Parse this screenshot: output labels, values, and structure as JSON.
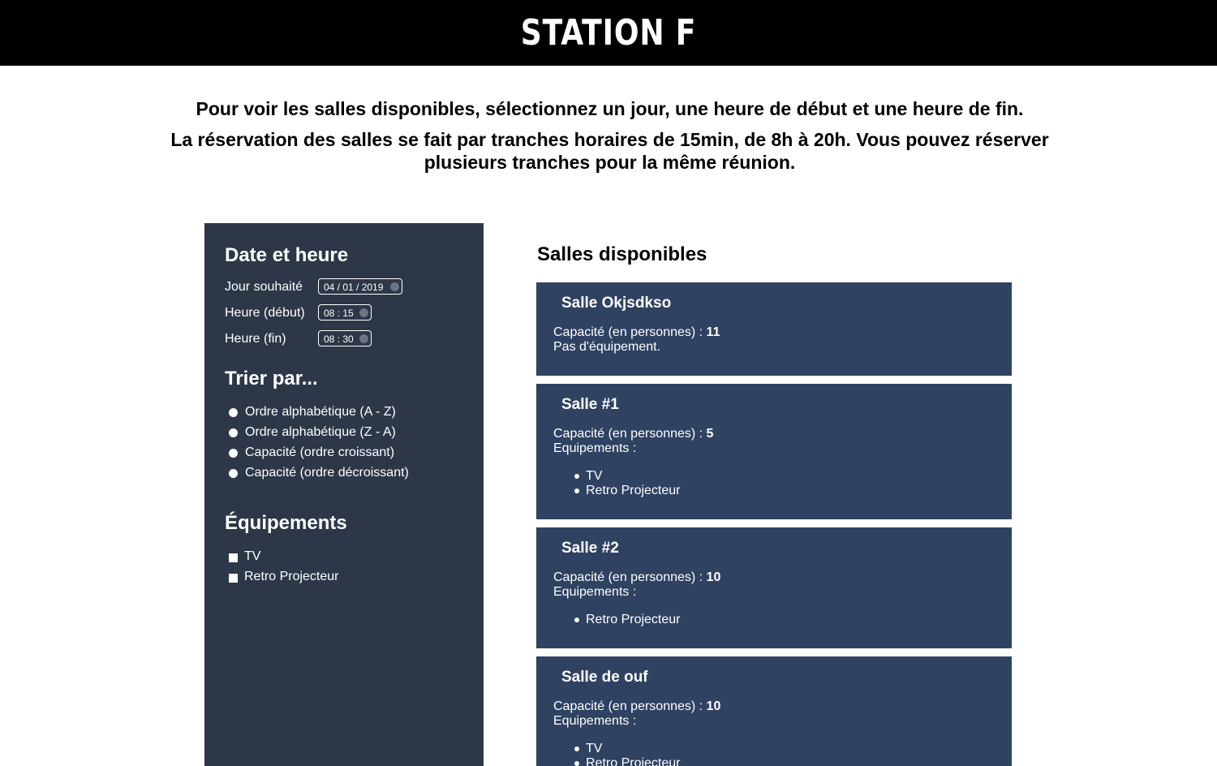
{
  "header": {
    "logo_text": "STATION F"
  },
  "intro": {
    "line1": "Pour voir les salles disponibles, sélectionnez un jour, une heure de début et une heure de fin.",
    "line2": "La réservation des salles se fait par tranches horaires de 15min, de 8h à 20h. Vous pouvez réserver plusieurs tranches pour la même réunion."
  },
  "sidebar": {
    "datetime_heading": "Date et heure",
    "fields": [
      {
        "label": "Jour souhaité",
        "value": "04 / 01 / 2019"
      },
      {
        "label": "Heure (début)",
        "value": "08 : 15"
      },
      {
        "label": "Heure (fin)",
        "value": "08 : 30"
      }
    ],
    "sort_heading": "Trier par...",
    "sort_options": [
      "Ordre alphabétique (A - Z)",
      "Ordre alphabétique (Z - A)",
      "Capacité (ordre croissant)",
      "Capacité (ordre décroissant)"
    ],
    "equipment_heading": "Équipements",
    "equipment_options": [
      "TV",
      "Retro Projecteur"
    ]
  },
  "main": {
    "title": "Salles disponibles",
    "capacity_label": "Capacité (en personnes) : ",
    "equipment_label": "Equipements :",
    "rooms": [
      {
        "name": "Salle Okjsdkso",
        "capacity": "11",
        "no_equipment": "Pas d'équipement.",
        "equipment": []
      },
      {
        "name": "Salle #1",
        "capacity": "5",
        "equipment": [
          "TV",
          "Retro Projecteur"
        ]
      },
      {
        "name": "Salle #2",
        "capacity": "10",
        "equipment": [
          "Retro Projecteur"
        ]
      },
      {
        "name": "Salle de ouf",
        "capacity": "10",
        "equipment": [
          "TV",
          "Retro Projecteur"
        ]
      }
    ]
  },
  "colors": {
    "topbar": "#000000",
    "sidebar": "#2d3748",
    "room_card": "#2f4262",
    "text_light": "#ffffff"
  }
}
